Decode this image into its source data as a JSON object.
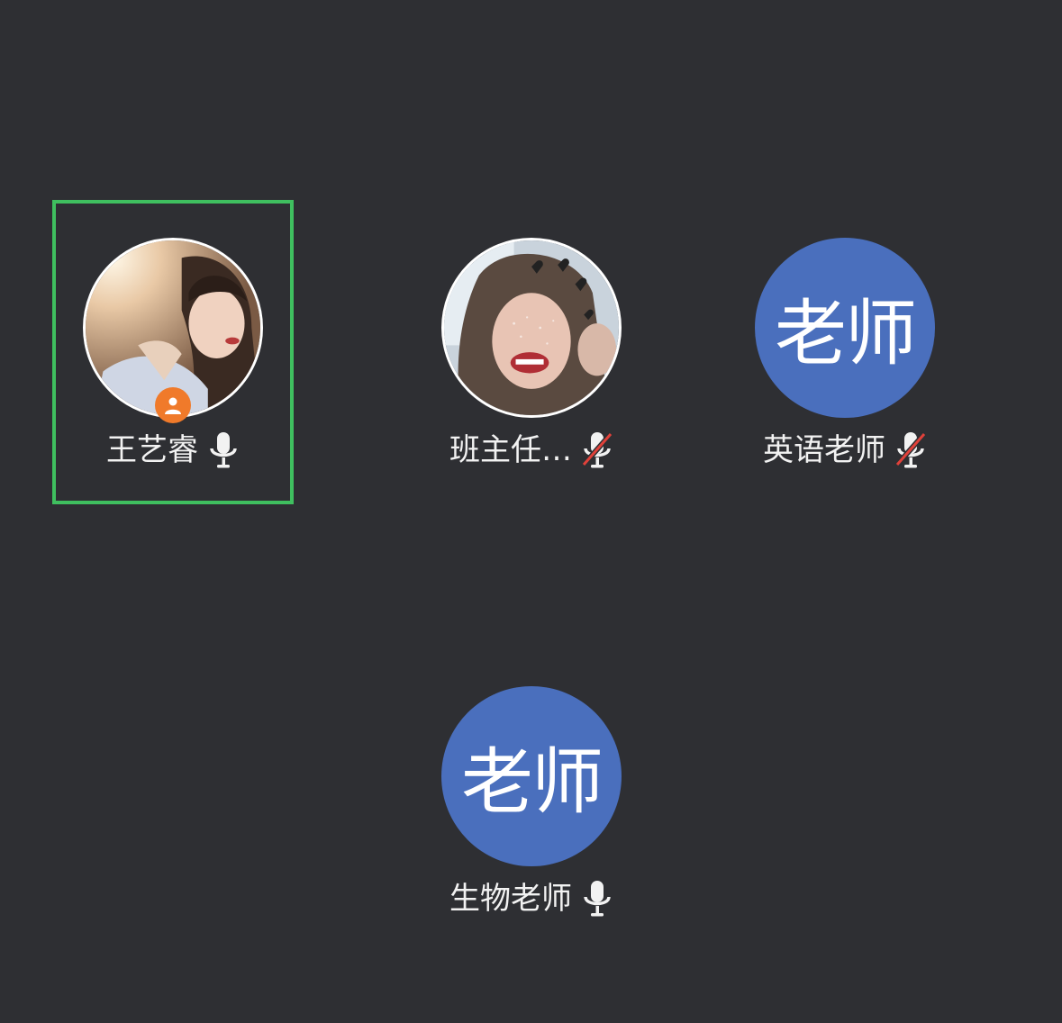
{
  "participants": [
    {
      "name": "王艺睿",
      "avatar_type": "photo",
      "is_host": true,
      "mic": "on",
      "active_speaker": true
    },
    {
      "name": "班主任…",
      "avatar_type": "photo",
      "is_host": false,
      "mic": "muted",
      "active_speaker": false
    },
    {
      "name": "英语老师",
      "avatar_type": "initials",
      "avatar_text": "老师",
      "is_host": false,
      "mic": "muted",
      "active_speaker": false
    },
    {
      "name": "生物老师",
      "avatar_type": "initials",
      "avatar_text": "老师",
      "is_host": false,
      "mic": "on",
      "active_speaker": false
    }
  ],
  "colors": {
    "background": "#2e2f33",
    "active_border": "#3fbf5f",
    "initials_avatar": "#4a6fbd",
    "host_badge": "#f07a2a",
    "muted_slash": "#e0413a"
  },
  "icons": {
    "mic_on": "microphone-icon",
    "mic_muted": "microphone-muted-icon",
    "host": "host-person-icon"
  }
}
